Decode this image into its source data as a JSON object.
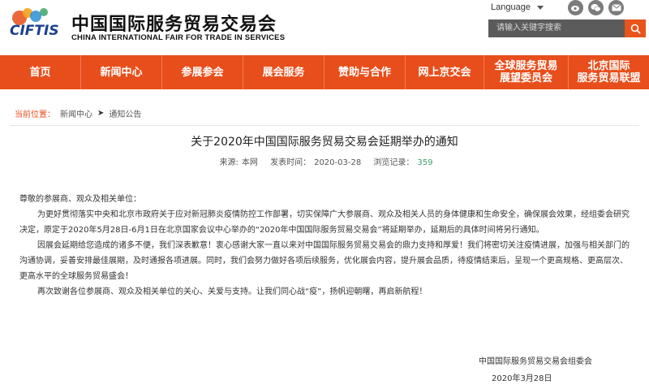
{
  "header": {
    "logo_text": "CIFTIS",
    "cn_name": "中国国际服务贸易交易会",
    "en_name": "CHINA INTERNATIONAL FAIR FOR TRADE IN SERVICES",
    "language_label": "Language",
    "search_placeholder": "请输入关键字搜索",
    "social_icons": [
      "weibo-icon",
      "wechat-icon",
      "email-icon"
    ],
    "colors": {
      "accent": "#e84e1b",
      "logo_blue": "#1b3f8f",
      "search_bg": "#5b5b5b"
    }
  },
  "nav": {
    "items": [
      {
        "label": "首页"
      },
      {
        "label": "新闻中心"
      },
      {
        "label": "参展参会"
      },
      {
        "label": "展会服务"
      },
      {
        "label": "赞助与合作"
      },
      {
        "label": "网上京交会"
      },
      {
        "label": "全球服务贸易\n展望委员会"
      },
      {
        "label": "北京国际\n服务贸易联盟"
      }
    ]
  },
  "breadcrumb": {
    "label": "当前位置：",
    "items": [
      "新闻中心",
      "通知公告"
    ],
    "separator": "➤"
  },
  "article": {
    "title": "关于2020年中国国际服务贸易交易会延期举办的通知",
    "source_label": "来源:",
    "source": "本网",
    "time_label": "发表时间：",
    "time": "2020-03-28",
    "views_label": "浏览记录：",
    "views": "359",
    "salutation": "尊敬的参展商、观众及相关单位：",
    "paragraphs": [
      "为更好贯彻落实中央和北京市政府关于应对新冠肺炎疫情防控工作部署，切实保障广大参展商、观众及相关人员的身体健康和生命安全，确保展会效果，经组委会研究决定，原定于2020年5月28日-6月1日在北京国家会议中心举办的“2020年中国国际服务贸易交易会”将延期举办，延期后的具体时间将另行通知。",
      "因展会延期给您造成的诸多不便，我们深表歉意！衷心感谢大家一直以来对中国国际服务贸易交易会的鼎力支持和厚爱！我们将密切关注疫情进展，加强与相关部门的沟通协调，妥善安排最佳展期，及时通报各项进展。同时，我们会努力做好各项后续服务，优化展会内容，提升展会品质，待疫情结束后，呈现一个更高规格、更高层次、更高水平的全球服务贸易盛会！",
      "再次致谢各位参展商、观众及相关单位的关心、关爱与支持。让我们同心战“疫”，扬帆迎朝曙，再启新航程！"
    ],
    "signature": "中国国际服务贸易交易会组委会",
    "signature_date": "2020年3月28日"
  }
}
